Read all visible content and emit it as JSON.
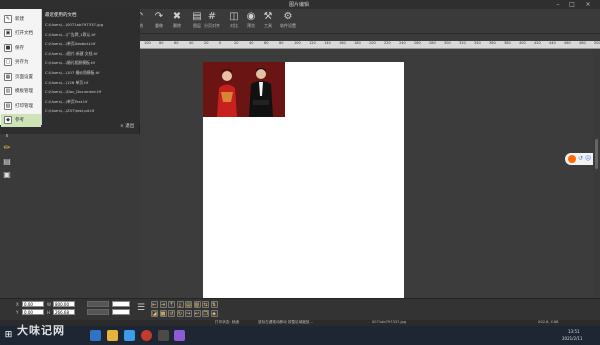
{
  "window": {
    "title": "图片编辑"
  },
  "toolbar": {
    "items": [
      {
        "label": "撤销",
        "icon": "undo-icon",
        "glyph": "↶"
      },
      {
        "label": "重做",
        "icon": "redo-icon",
        "glyph": "↷"
      },
      {
        "label": "删除",
        "icon": "delete-icon",
        "glyph": "✖"
      },
      {
        "label": "图层",
        "icon": "layer-icon",
        "glyph": "▤"
      },
      {
        "label": "分页对齐",
        "icon": "grid-icon",
        "glyph": "#"
      },
      {
        "label": "对比",
        "icon": "compare-icon",
        "glyph": "◫"
      },
      {
        "label": "预览",
        "icon": "preview-icon",
        "glyph": "◉"
      },
      {
        "label": "工具",
        "icon": "wrench-icon",
        "glyph": "⚒"
      },
      {
        "label": "软件设置",
        "icon": "gear-icon",
        "glyph": "⚙"
      }
    ]
  },
  "ruler": {
    "ticks": [
      "100",
      "80",
      "60",
      "40",
      "20",
      "0",
      "20",
      "40",
      "60",
      "80",
      "100",
      "120",
      "140",
      "160",
      "180",
      "200",
      "220",
      "240",
      "260",
      "280",
      "300",
      "320",
      "340",
      "360",
      "380",
      "400",
      "420",
      "440",
      "460",
      "480",
      "500"
    ]
  },
  "file_menu": {
    "items": [
      {
        "label": "新建",
        "icon": "new-file-icon"
      },
      {
        "label": "打开文档",
        "icon": "open-folder-icon"
      },
      {
        "label": "保存",
        "icon": "save-icon"
      },
      {
        "label": "另存为",
        "icon": "save-as-icon"
      },
      {
        "label": "页面设置",
        "icon": "page-setup-icon"
      },
      {
        "label": "模板管理",
        "icon": "template-icon"
      },
      {
        "label": "打印管理",
        "icon": "printer-icon"
      },
      {
        "label": "参考",
        "icon": "reference-icon"
      }
    ],
    "recent_header": "最近使用的文档",
    "recent": [
      "C:\\Users\\...\\0071ab797337.jpg",
      "C:\\Users\\...\\广告牌_1默认.tif",
      "C:\\Users\\...\\单页AdobeLt.tif",
      "C:\\Users\\...\\图片-新建 文档.tif",
      "C:\\Users\\...\\婚礼相册模板.tif",
      "C:\\Users\\...\\107 婚纱照模板.tif",
      "C:\\Users\\...\\126 单页.tif",
      "C:\\Users\\...\\Doc_Document.tif",
      "C:\\Users\\...\\单页Test.tif",
      "C:\\Users\\...\\Z07\\test.pd.tif"
    ],
    "exit_label": "退出"
  },
  "props": {
    "x_label": "X",
    "x_value": "0.00",
    "w_label": "W",
    "w_value": "800.00",
    "y_label": "Y",
    "y_value": "0.00",
    "h_label": "H",
    "h_value": "266.68"
  },
  "status": {
    "left": "打印状态: 就绪",
    "mid": "鼠标左键拖动移动 按整区域缩放...",
    "file": "0071ab797337.jpg",
    "right": "X02.8, Y-68"
  },
  "taskbar": {
    "time": "13:51",
    "date": "2021/2/11"
  },
  "watermark": "大味记网",
  "colors": {
    "accent": "#ff6a00",
    "menu_bg": "#2e2e2e",
    "photo_bg": "#6b1414"
  }
}
